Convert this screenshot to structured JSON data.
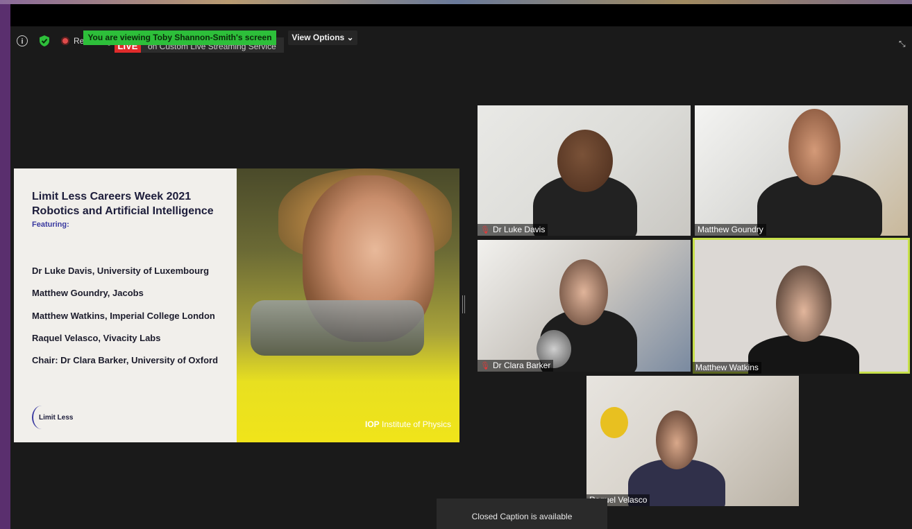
{
  "top_bar": {
    "viewing_banner": "You are viewing Toby Shannon-Smith's screen",
    "view_options": "View Options ⌄",
    "recording_label": "Recording",
    "live_badge": "LIVE",
    "live_service": "on Custom Live Streaming Service"
  },
  "slide": {
    "title_line1": "Limit Less Careers Week 2021",
    "title_line2": "Robotics and Artificial Intelligence",
    "featuring": "Featuring:",
    "speakers": [
      "Dr Luke Davis, University of Luxembourg",
      "Matthew Goundry, Jacobs",
      "Matthew Watkins, Imperial College London",
      "Raquel Velasco, Vivacity Labs",
      "Chair: Dr Clara Barker, University of Oxford"
    ],
    "logo_text": "Limit Less",
    "iop_bold": "IOP",
    "iop_rest": " Institute of Physics"
  },
  "participants": [
    {
      "name": "Dr Luke Davis",
      "muted": true
    },
    {
      "name": "Matthew Goundry",
      "muted": false
    },
    {
      "name": "Dr Clara Barker",
      "muted": true
    },
    {
      "name": "Matthew Watkins",
      "muted": false,
      "active_speaker": true
    },
    {
      "name": "Raquel Velasco",
      "muted": false
    }
  ],
  "caption_toast": "Closed Caption is available",
  "colors": {
    "banner_green": "#2dbf3a",
    "live_red": "#e02b2b",
    "active_speaker_outline": "#c7e04a",
    "app_background": "#1a1a1a"
  },
  "icons": [
    "info-icon",
    "shield-check-icon",
    "recording-dot-icon",
    "exit-fullscreen-icon",
    "mic-muted-icon"
  ]
}
